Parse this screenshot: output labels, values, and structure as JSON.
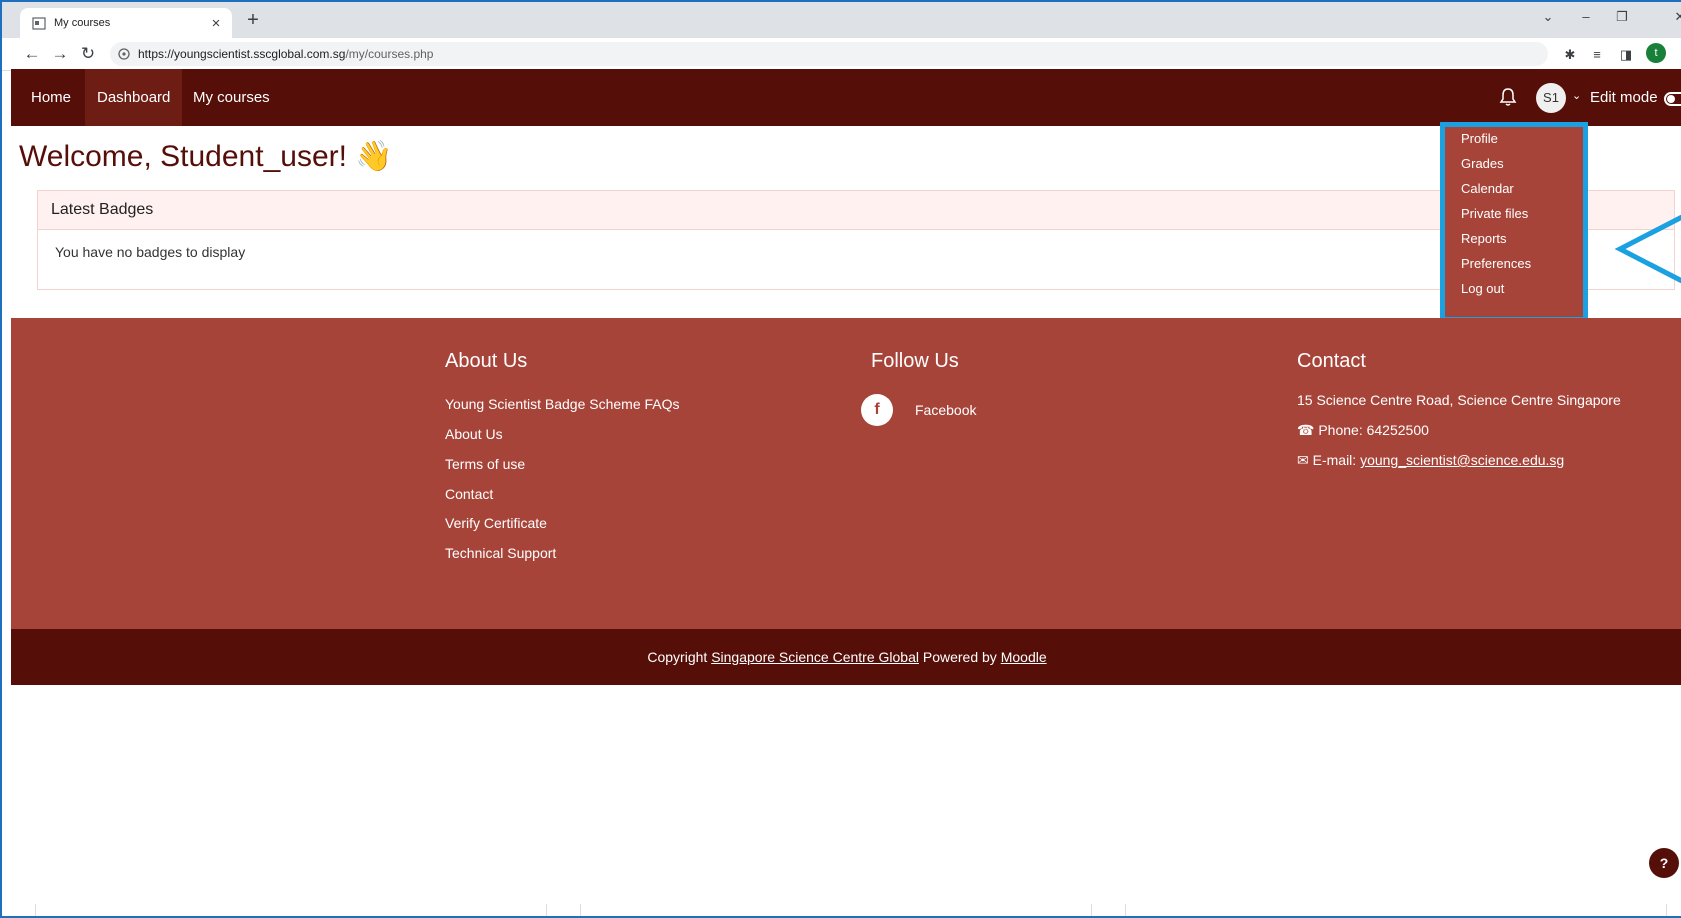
{
  "browser": {
    "tab_title": "My courses",
    "tab_close": "×",
    "new_tab": "+",
    "url_host": "https://youngscientist.sscglobal.com.sg",
    "url_path": "/my/courses.php",
    "profile_initial": "t"
  },
  "navbar": {
    "items": [
      "Home",
      "Dashboard",
      "My courses"
    ],
    "avatar_initials": "S1",
    "edit_mode_label": "Edit mode"
  },
  "main": {
    "welcome": "Welcome, Student_user! 👋",
    "badges_header": "Latest Badges",
    "badges_empty": "You have no badges to display"
  },
  "user_menu": {
    "items": [
      "Profile",
      "Grades",
      "Calendar",
      "Private files",
      "Reports",
      "Preferences",
      "Log out"
    ]
  },
  "footer": {
    "about": {
      "title": "About Us",
      "links": [
        "Young Scientist Badge Scheme FAQs",
        "About Us",
        "Terms of use",
        "Contact",
        "Verify Certificate",
        "Technical Support"
      ]
    },
    "follow": {
      "title": "Follow Us",
      "facebook": "Facebook"
    },
    "contact": {
      "title": "Contact",
      "address": "15 Science Centre Road, Science Centre Singapore",
      "phone": "Phone: 64252500",
      "email_label": "E-mail:",
      "email": "young_scientist@science.edu.sg"
    }
  },
  "copyright": {
    "prefix": "Copyright",
    "org": "Singapore Science Centre Global",
    "powered": "Powered by",
    "moodle": "Moodle"
  },
  "help_button": "?",
  "colors": {
    "navbar": "#560f08",
    "footer": "#a7443a",
    "highlight": "#1ba1e2"
  }
}
